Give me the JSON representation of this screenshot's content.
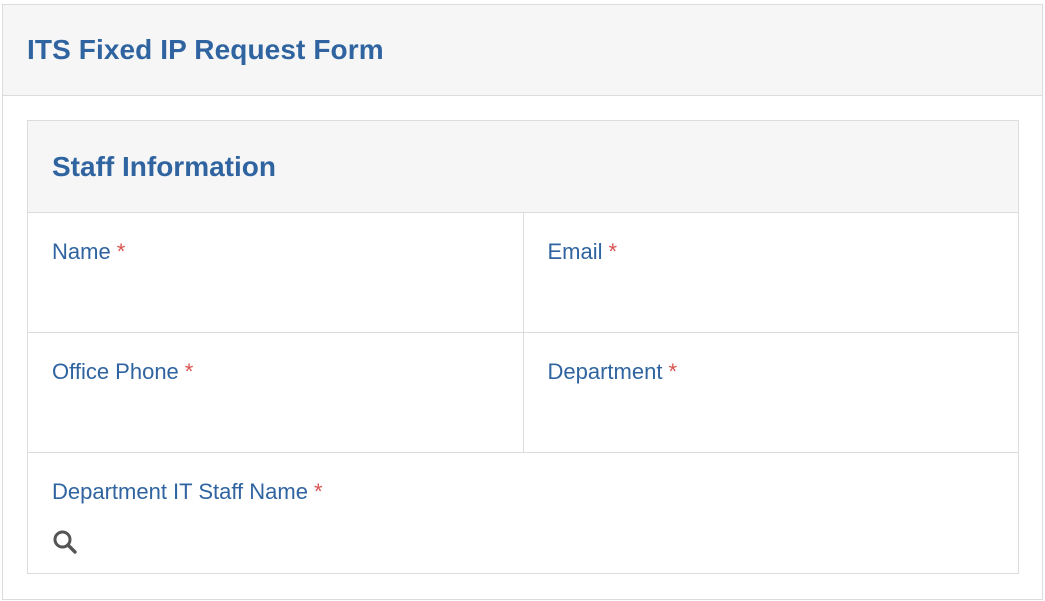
{
  "form": {
    "title": "ITS Fixed IP Request Form"
  },
  "section": {
    "title": "Staff Information",
    "fields": {
      "name": {
        "label": "Name",
        "required_marker": "*",
        "value": ""
      },
      "email": {
        "label": "Email",
        "required_marker": "*",
        "value": ""
      },
      "office_phone": {
        "label": "Office Phone",
        "required_marker": "*",
        "value": ""
      },
      "department": {
        "label": "Department",
        "required_marker": "*",
        "value": ""
      },
      "it_staff_name": {
        "label": "Department IT Staff Name",
        "required_marker": "*",
        "value": "",
        "icon": "search-icon"
      }
    }
  },
  "colors": {
    "accent": "#2f64a0",
    "required": "#d9534f",
    "header_bg": "#f6f6f6",
    "border": "#dcdcdc",
    "icon": "#555555"
  }
}
